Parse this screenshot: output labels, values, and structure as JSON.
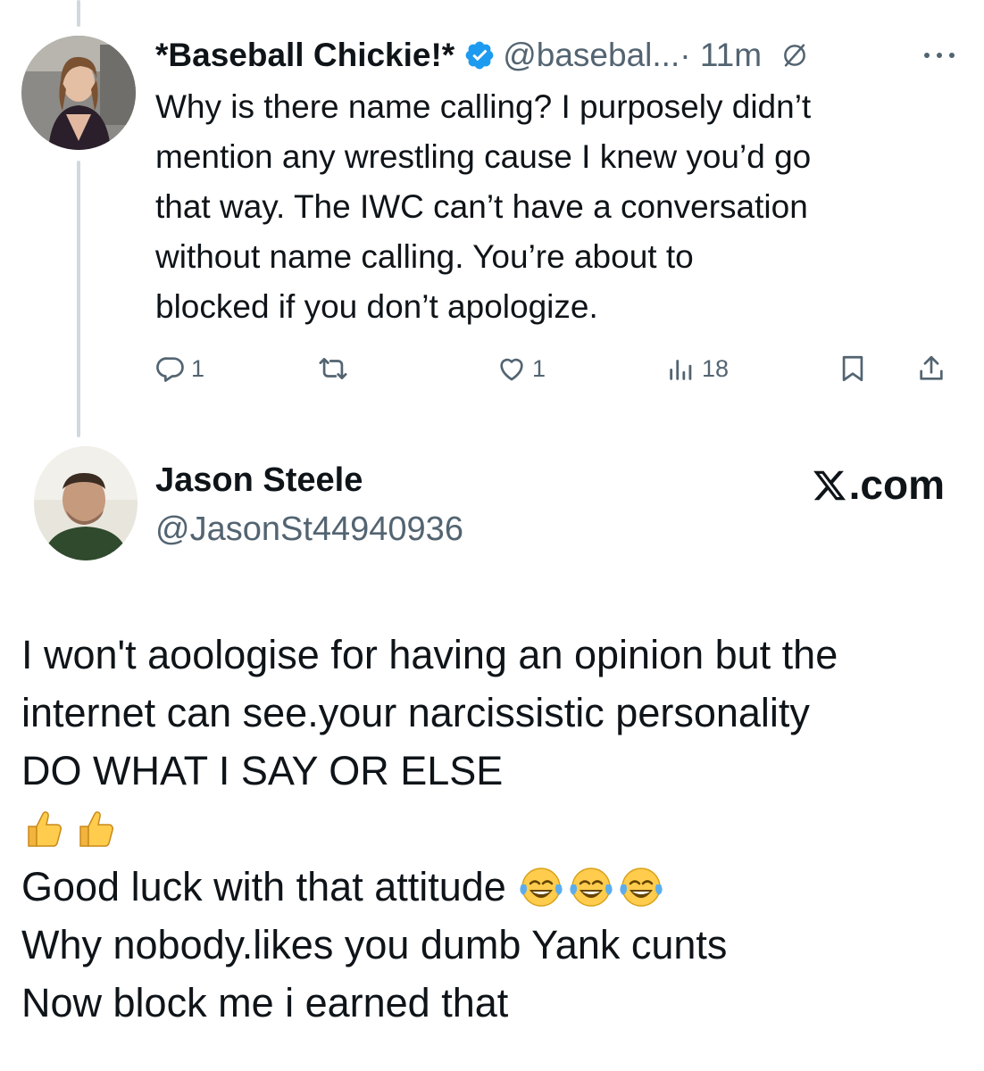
{
  "tweet1": {
    "author": {
      "display_name": "*Baseball Chickie!*",
      "verified": true,
      "handle": "@basebal...",
      "time": "· 11m"
    },
    "body_lines": [
      "Why is there name calling? I purposely didn’t",
      "mention any wrestling cause I knew you’d go",
      "that way. The IWC can’t have a conversation",
      "without name calling. You’re about to",
      "blocked if you don’t apologize."
    ],
    "actions": {
      "replies": "1",
      "reposts": "",
      "likes": "1",
      "views": "18"
    }
  },
  "tweet2": {
    "author": {
      "display_name": "Jason Steele",
      "handle": "@JasonSt44940936"
    },
    "brand": ".com",
    "body": {
      "line1": "I won't aoologise for having an opinion but the",
      "line2": "internet can see.your narcissistic personality",
      "line3": "DO WHAT I SAY OR ELSE",
      "emoji_line": [
        "thumbs-up",
        "thumbs-up"
      ],
      "line5": "Good luck with that attitude",
      "line5_emoji": [
        "tears-of-joy",
        "tears-of-joy",
        "tears-of-joy"
      ],
      "line6": "Why nobody.likes you dumb Yank cunts",
      "line7": "Now block me i earned that"
    }
  },
  "colors": {
    "text": "#0f1419",
    "secondary": "#536471",
    "verified": "#1d9bf0",
    "thread_line": "#cfd9de"
  }
}
